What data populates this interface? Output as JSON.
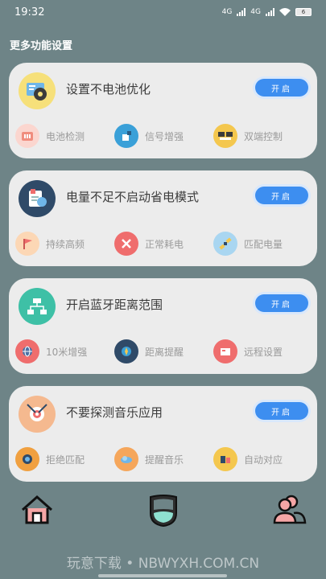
{
  "status": {
    "time": "19:32",
    "net1": "4G",
    "net2": "4G",
    "battery": "6"
  },
  "section_title": "更多功能设置",
  "cards": [
    {
      "title": "设置不电池优化",
      "button": "开启",
      "head_icon": "gear-settings-icon",
      "features": [
        {
          "label": "电池检测",
          "icon": "battery-test-icon",
          "color": "#f08d7e"
        },
        {
          "label": "信号增强",
          "icon": "signal-boost-icon",
          "color": "#3aa0d8"
        },
        {
          "label": "双端控制",
          "icon": "dual-control-icon",
          "color": "#f4c74e"
        }
      ]
    },
    {
      "title": "电量不足不启动省电模式",
      "button": "开启",
      "head_icon": "power-mode-icon",
      "features": [
        {
          "label": "持续高频",
          "icon": "flag-icon",
          "color": "#f5a65b"
        },
        {
          "label": "正常耗电",
          "icon": "tools-icon",
          "color": "#ef6d6d"
        },
        {
          "label": "匹配电量",
          "icon": "satellite-icon",
          "color": "#6ab7e6"
        }
      ]
    },
    {
      "title": "开启蓝牙距离范围",
      "button": "开启",
      "head_icon": "network-range-icon",
      "features": [
        {
          "label": "10米增强",
          "icon": "globe-icon",
          "color": "#ef6d6d"
        },
        {
          "label": "距离提醒",
          "icon": "compass-icon",
          "color": "#2f4a68"
        },
        {
          "label": "远程设置",
          "icon": "remote-panel-icon",
          "color": "#ef6d6d"
        }
      ]
    },
    {
      "title": "不要探测音乐应用",
      "button": "开启",
      "head_icon": "target-icon",
      "features": [
        {
          "label": "拒绝匹配",
          "icon": "speaker-icon",
          "color": "#f0a040"
        },
        {
          "label": "提醒音乐",
          "icon": "music-cloud-icon",
          "color": "#f5a65b"
        },
        {
          "label": "自动对应",
          "icon": "devices-icon",
          "color": "#f4c74e"
        }
      ]
    }
  ],
  "nav": {
    "items": [
      "home-icon",
      "shield-icon",
      "users-icon"
    ]
  },
  "watermark": "玩意下载 • NBWYXH.COM.CN"
}
